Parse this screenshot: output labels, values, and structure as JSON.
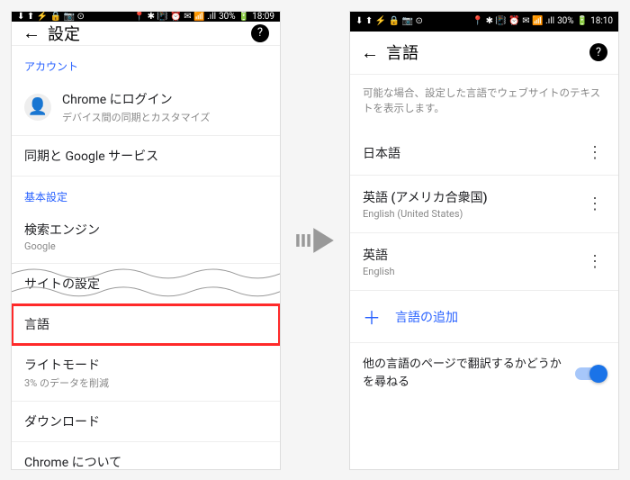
{
  "statusbar": {
    "left_icons": "⬇ ⬆ ⚡ 🔒 📷 ⊙",
    "right_icons": "📍 ✱ 📳 ⏰ ✉ 📶 .ıll",
    "battery": "30%",
    "time_left": "18:09",
    "time_right": "18:10"
  },
  "left": {
    "title": "設定",
    "account_label": "アカウント",
    "signin_title": "Chrome にログイン",
    "signin_sub": "デバイス間の同期とカスタマイズ",
    "sync": "同期と Google サービス",
    "basic_label": "基本設定",
    "search_title": "検索エンジン",
    "search_sub": "Google",
    "site_settings": "サイトの設定",
    "language": "言語",
    "lite_title": "ライトモード",
    "lite_sub": "3% のデータを削減",
    "downloads": "ダウンロード",
    "about": "Chrome について"
  },
  "right": {
    "title": "言語",
    "desc": "可能な場合、設定した言語でウェブサイトのテキストを表示します。",
    "lang1": {
      "name": "日本語"
    },
    "lang2": {
      "name": "英語 (アメリカ合衆国)",
      "sub": "English (United States)"
    },
    "lang3": {
      "name": "英語",
      "sub": "English"
    },
    "add": "言語の追加",
    "translate": "他の言語のページで翻訳するかどうかを尋ねる"
  }
}
